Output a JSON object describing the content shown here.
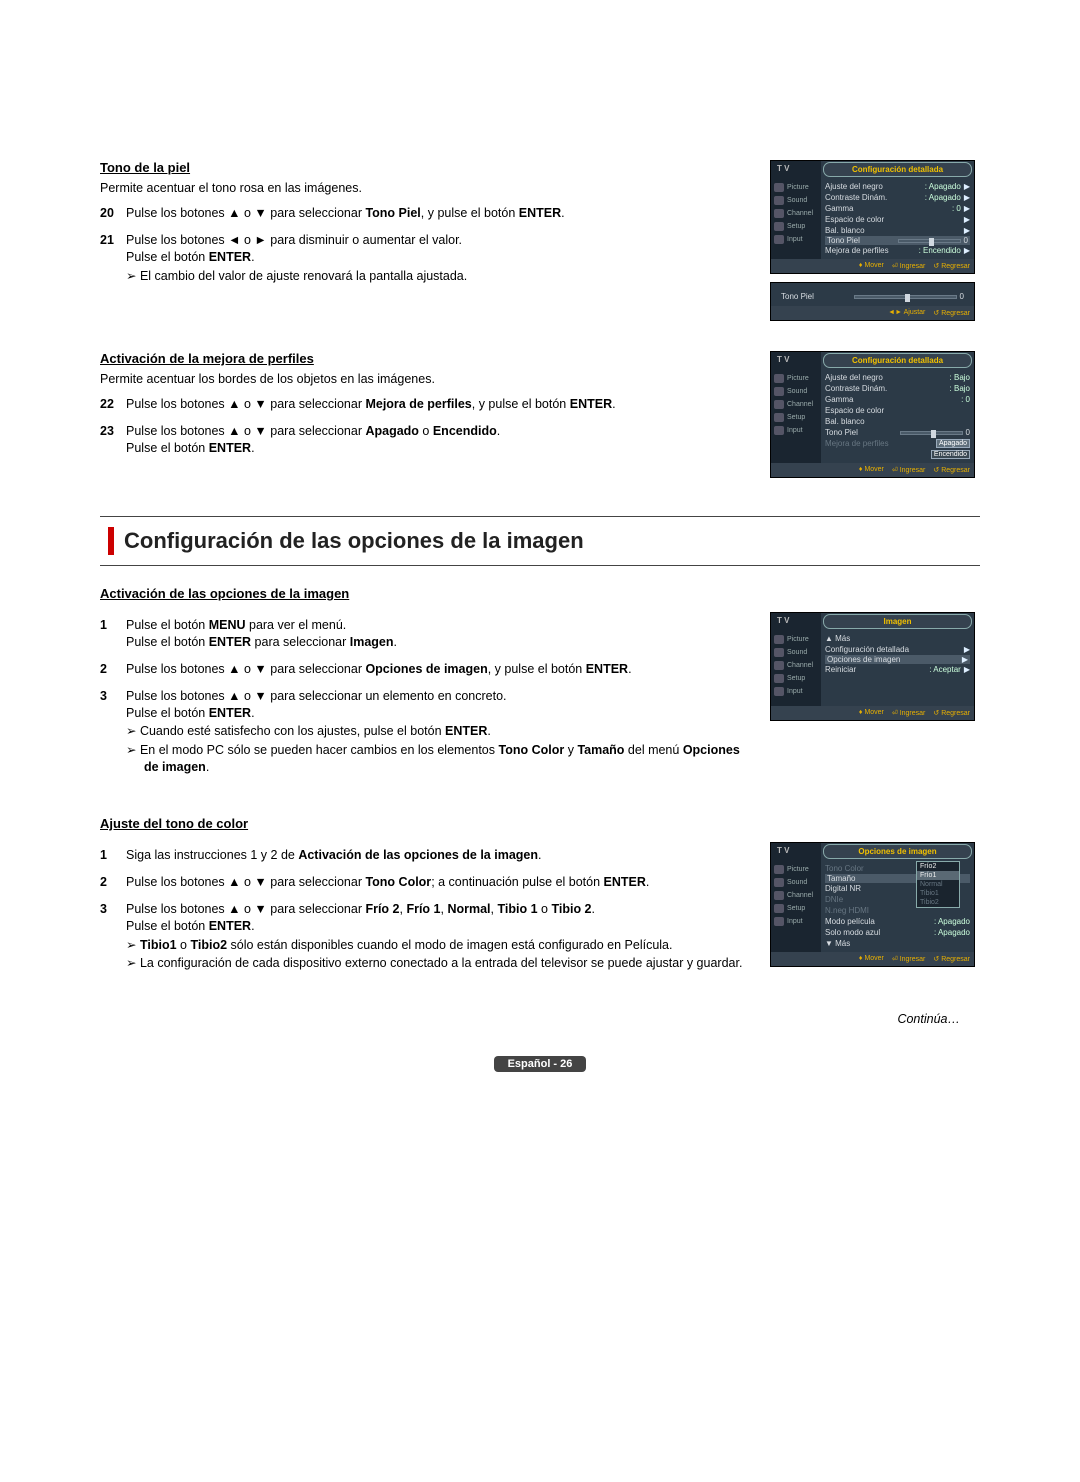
{
  "s1": {
    "title": "Tono de la piel",
    "desc": "Permite acentuar el tono rosa en las imágenes.",
    "steps": [
      {
        "n": "20",
        "a": "Pulse los botones ▲ o ▼ para seleccionar ",
        "b1": "Tono Piel",
        "a2": ", y pulse el botón ",
        "b2": "ENTER",
        "a3": "."
      },
      {
        "n": "21",
        "a": "Pulse los botones ◄ o ► para disminuir o aumentar el valor.",
        "line2a": "Pulse el botón ",
        "line2b": "ENTER",
        "line2c": ".",
        "sub": "➢ El cambio del valor de ajuste renovará la pantalla ajustada."
      }
    ]
  },
  "s2": {
    "title": "Activación de la mejora de perfiles",
    "desc": "Permite acentuar los bordes de los objetos en las imágenes.",
    "steps": [
      {
        "n": "22",
        "a": "Pulse los botones ▲ o ▼ para seleccionar ",
        "b1": "Mejora de perfiles",
        "a2": ", y pulse el botón ",
        "b2": "ENTER",
        "a3": "."
      },
      {
        "n": "23",
        "a": "Pulse los botones ▲ o ▼ para seleccionar ",
        "b1": "Apagado",
        "a2": " o ",
        "b2": "Encendido",
        "a3": ".",
        "line2a": "Pulse el botón ",
        "line2b": "ENTER",
        "line2c": "."
      }
    ]
  },
  "s3": {
    "heading": "Configuración de las opciones de la imagen",
    "sub1": {
      "title": "Activación de las opciones de la imagen",
      "steps": [
        {
          "n": "1",
          "a": "Pulse el botón ",
          "b1": "MENU",
          "a2": " para ver el menú.",
          "line2a": "Pulse el botón ",
          "line2b": "ENTER",
          "line2c": " para seleccionar ",
          "line2d": "Imagen",
          "line2e": "."
        },
        {
          "n": "2",
          "a": "Pulse los botones ▲ o ▼ para seleccionar ",
          "b1": "Opciones de imagen",
          "a2": ", y pulse el botón ",
          "b2": "ENTER",
          "a3": "."
        },
        {
          "n": "3",
          "a": "Pulse los botones ▲ o ▼ para seleccionar un elemento en concreto.",
          "line2a": "Pulse el botón ",
          "line2b": "ENTER",
          "line2c": ".",
          "sub1": "➢ Cuando esté satisfecho con los ajustes, pulse el botón ",
          "sub1b": "ENTER",
          "sub1c": ".",
          "sub2a": "➢ En el modo PC sólo se pueden hacer cambios en los elementos ",
          "sub2b": "Tono Color",
          "sub2c": " y ",
          "sub2d": "Tamaño",
          "sub2e": " del menú ",
          "sub2f": "Opciones de imagen",
          "sub2g": "."
        }
      ]
    },
    "sub2": {
      "title": "Ajuste del tono de color",
      "steps": [
        {
          "n": "1",
          "a": "Siga las instrucciones 1 y 2 de ",
          "b1": "Activación de las opciones de la imagen",
          "a2": "."
        },
        {
          "n": "2",
          "a": "Pulse los botones ▲ o ▼ para seleccionar ",
          "b1": "Tono Color",
          "a2": "; a continuación pulse el botón ",
          "b2": "ENTER",
          "a3": "."
        },
        {
          "n": "3",
          "a": "Pulse los botones ▲ o ▼ para seleccionar ",
          "b1": "Frío 2",
          "a2": ", ",
          "b2": "Frío 1",
          "a3": ", ",
          "b3": "Normal",
          "a4": ", ",
          "b4": "Tibio 1",
          "a5": " o ",
          "b5": "Tibio 2",
          "a6": ".",
          "line2a": "Pulse el botón ",
          "line2b": "ENTER",
          "line2c": ".",
          "sub1a": "➢ ",
          "sub1b": "Tibio1",
          "sub1c": " o ",
          "sub1d": "Tibio2",
          "sub1e": " sólo están disponibles cuando el modo de imagen está configurado en Película.",
          "sub2": "➢ La configuración de cada dispositivo externo conectado a la entrada del televisor se puede ajustar y guardar."
        }
      ]
    }
  },
  "continue": "Continúa…",
  "footer": "Español - 26",
  "osd": {
    "tv": "T V",
    "title_detail": "Configuración detallada",
    "title_image": "Imagen",
    "title_options": "Opciones de imagen",
    "side": [
      "Picture",
      "Sound",
      "Channel",
      "Setup",
      "Input"
    ],
    "panel1": {
      "rows": [
        {
          "l": "Ajuste del negro",
          "v": ": Apagado"
        },
        {
          "l": "Contraste Dinám.",
          "v": ": Apagado"
        },
        {
          "l": "Gamma",
          "v": ": 0"
        },
        {
          "l": "Espacio de color",
          "v": ""
        },
        {
          "l": "Bal. blanco",
          "v": ""
        }
      ],
      "slider": {
        "l": "Tono Piel",
        "v": "0"
      },
      "last": {
        "l": "Mejora de perfiles",
        "v": ": Encendido"
      }
    },
    "panel_mini": {
      "l": "Tono Piel",
      "v": "0"
    },
    "panel2": {
      "rows": [
        {
          "l": "Ajuste del negro",
          "v": ": Bajo"
        },
        {
          "l": "Contraste Dinám.",
          "v": ": Bajo"
        },
        {
          "l": "Gamma",
          "v": ": 0"
        },
        {
          "l": "Espacio de color",
          "v": ""
        },
        {
          "l": "Bal. blanco",
          "v": ""
        }
      ],
      "slider": {
        "l": "Tono Piel",
        "v": "0"
      },
      "dim": "Mejora de perfiles",
      "popup": [
        "Apagado",
        "Encendido"
      ]
    },
    "panel3": {
      "more_up": "▲ Más",
      "rows": [
        {
          "l": "Configuración detallada",
          "v": ""
        },
        {
          "l": "Opciones de imagen",
          "v": "",
          "hl": true
        },
        {
          "l": "Reiniciar",
          "v": ": Aceptar"
        }
      ]
    },
    "panel4": {
      "rows": [
        {
          "l": "Tono Color",
          "dim": true
        },
        {
          "l": "Tamaño",
          "hl": true
        },
        {
          "l": "Digital NR"
        },
        {
          "l": "DNIe",
          "dim": true
        },
        {
          "l": "N.neg HDMI",
          "dim": true
        },
        {
          "l": "Modo película",
          "v": ": Apagado"
        },
        {
          "l": "Solo modo azul",
          "v": ": Apagado"
        }
      ],
      "more_down": "▼ Más",
      "popup": [
        "Frío2",
        "Frío1",
        "Normal",
        "Tibio1",
        "Tibio2"
      ]
    },
    "foot": {
      "mover": "Mover",
      "ingresar": "Ingresar",
      "regresar": "Regresar",
      "ajustar": "Ajustar"
    }
  }
}
